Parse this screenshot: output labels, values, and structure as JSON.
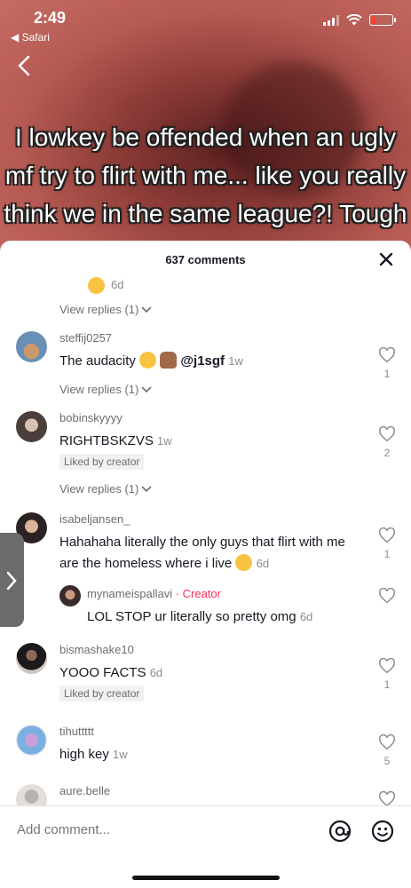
{
  "status": {
    "time": "2:49",
    "back_app": "◀ Safari"
  },
  "video": {
    "caption": "I lowkey be offended when an ugly mf try to flirt with me... like you really think we in the same league?! Tough"
  },
  "sheet": {
    "title": "637 comments",
    "close_icon": "close-icon"
  },
  "comments": [
    {
      "time": "6d",
      "view_replies": "View replies (1)"
    },
    {
      "username": "steffij0257",
      "text": "The audacity",
      "mention": "@j1sgf",
      "time": "1w",
      "likes": "1",
      "view_replies": "View replies (1)"
    },
    {
      "username": "bobinskyyyy",
      "text": "RIGHTBSKZVS",
      "time": "1w",
      "likes": "2",
      "badge": "Liked by creator",
      "view_replies": "View replies (1)"
    },
    {
      "username": "isabeljansen_",
      "text": "Hahahaha literally the only guys that flirt with me are the homeless where i live",
      "time": "6d",
      "likes": "1",
      "reply": {
        "username": "mynameispallavi",
        "creator_label": " · Creator",
        "text": "LOL STOP ur literally so pretty omg",
        "time": "6d"
      }
    },
    {
      "username": "bismashake10",
      "text": "YOOO FACTS",
      "time": "6d",
      "likes": "1",
      "badge": "Liked by creator"
    },
    {
      "username": "tihuttttt",
      "text": "high key",
      "time": "1w",
      "likes": "5"
    },
    {
      "username": "aure.belle"
    }
  ],
  "composer": {
    "placeholder": "Add comment..."
  },
  "colors": {
    "accent": "#fe2c55",
    "text": "#161823",
    "muted": "#8a8b91"
  }
}
